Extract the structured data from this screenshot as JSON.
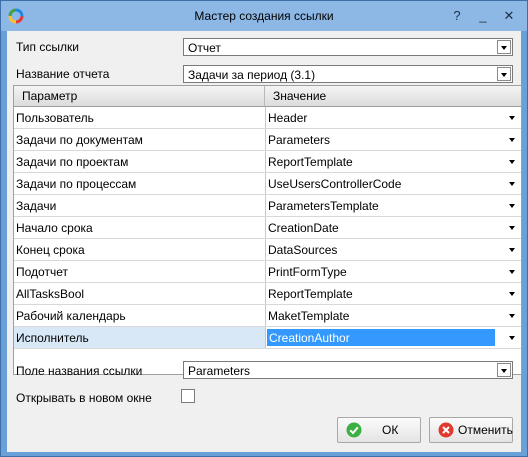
{
  "window": {
    "title": "Мастер создания ссылки",
    "controls": {
      "help": "?",
      "minimize": "_",
      "close": "✕"
    }
  },
  "form": {
    "link_type_label": "Тип ссылки",
    "link_type_value": "Отчет",
    "report_name_label": "Название отчета",
    "report_name_value": "Задачи за период (3.1)",
    "link_name_field_label": "Поле названия ссылки",
    "link_name_field_value": "Parameters",
    "open_new_window_label": "Открывать в новом окне",
    "open_new_window_checked": false
  },
  "grid": {
    "columns": [
      "Параметр",
      "Значение"
    ],
    "rows": [
      {
        "param": "Пользователь",
        "value": "Header"
      },
      {
        "param": "Задачи по документам",
        "value": "Parameters"
      },
      {
        "param": "Задачи по проектам",
        "value": "ReportTemplate"
      },
      {
        "param": "Задачи по процессам",
        "value": "UseUsersControllerCode"
      },
      {
        "param": "Задачи",
        "value": "ParametersTemplate"
      },
      {
        "param": "Начало срока",
        "value": "CreationDate"
      },
      {
        "param": "Конец срока",
        "value": "DataSources"
      },
      {
        "param": "Подотчет",
        "value": "PrintFormType"
      },
      {
        "param": "AllTasksBool",
        "value": "ReportTemplate"
      },
      {
        "param": "Рабочий календарь",
        "value": "MaketTemplate"
      },
      {
        "param": "Исполнитель",
        "value": "CreationAuthor",
        "selected": true
      }
    ]
  },
  "buttons": {
    "ok": "ОК",
    "cancel": "Отменить"
  },
  "colors": {
    "titlebar": "#8db8e6",
    "selection": "#3399ff",
    "ok_icon": "#3cb043",
    "cancel_icon": "#e03a2f"
  }
}
